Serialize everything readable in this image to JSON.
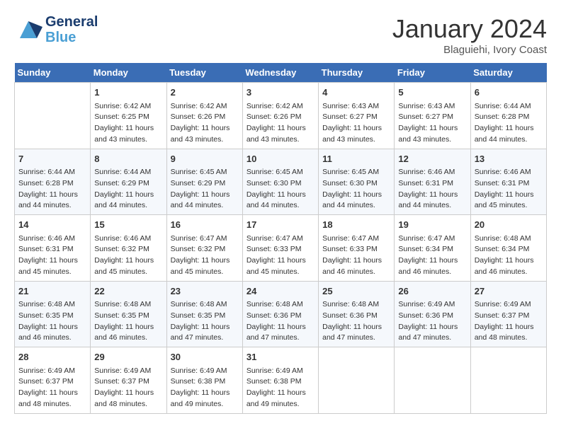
{
  "header": {
    "logo_line1": "General",
    "logo_line2": "Blue",
    "month": "January 2024",
    "location": "Blaguiehi, Ivory Coast"
  },
  "days_of_week": [
    "Sunday",
    "Monday",
    "Tuesday",
    "Wednesday",
    "Thursday",
    "Friday",
    "Saturday"
  ],
  "weeks": [
    [
      {
        "day": "",
        "sunrise": "",
        "sunset": "",
        "daylight": ""
      },
      {
        "day": "1",
        "sunrise": "Sunrise: 6:42 AM",
        "sunset": "Sunset: 6:25 PM",
        "daylight": "Daylight: 11 hours and 43 minutes."
      },
      {
        "day": "2",
        "sunrise": "Sunrise: 6:42 AM",
        "sunset": "Sunset: 6:26 PM",
        "daylight": "Daylight: 11 hours and 43 minutes."
      },
      {
        "day": "3",
        "sunrise": "Sunrise: 6:42 AM",
        "sunset": "Sunset: 6:26 PM",
        "daylight": "Daylight: 11 hours and 43 minutes."
      },
      {
        "day": "4",
        "sunrise": "Sunrise: 6:43 AM",
        "sunset": "Sunset: 6:27 PM",
        "daylight": "Daylight: 11 hours and 43 minutes."
      },
      {
        "day": "5",
        "sunrise": "Sunrise: 6:43 AM",
        "sunset": "Sunset: 6:27 PM",
        "daylight": "Daylight: 11 hours and 43 minutes."
      },
      {
        "day": "6",
        "sunrise": "Sunrise: 6:44 AM",
        "sunset": "Sunset: 6:28 PM",
        "daylight": "Daylight: 11 hours and 44 minutes."
      }
    ],
    [
      {
        "day": "7",
        "sunrise": "Sunrise: 6:44 AM",
        "sunset": "Sunset: 6:28 PM",
        "daylight": "Daylight: 11 hours and 44 minutes."
      },
      {
        "day": "8",
        "sunrise": "Sunrise: 6:44 AM",
        "sunset": "Sunset: 6:29 PM",
        "daylight": "Daylight: 11 hours and 44 minutes."
      },
      {
        "day": "9",
        "sunrise": "Sunrise: 6:45 AM",
        "sunset": "Sunset: 6:29 PM",
        "daylight": "Daylight: 11 hours and 44 minutes."
      },
      {
        "day": "10",
        "sunrise": "Sunrise: 6:45 AM",
        "sunset": "Sunset: 6:30 PM",
        "daylight": "Daylight: 11 hours and 44 minutes."
      },
      {
        "day": "11",
        "sunrise": "Sunrise: 6:45 AM",
        "sunset": "Sunset: 6:30 PM",
        "daylight": "Daylight: 11 hours and 44 minutes."
      },
      {
        "day": "12",
        "sunrise": "Sunrise: 6:46 AM",
        "sunset": "Sunset: 6:31 PM",
        "daylight": "Daylight: 11 hours and 44 minutes."
      },
      {
        "day": "13",
        "sunrise": "Sunrise: 6:46 AM",
        "sunset": "Sunset: 6:31 PM",
        "daylight": "Daylight: 11 hours and 45 minutes."
      }
    ],
    [
      {
        "day": "14",
        "sunrise": "Sunrise: 6:46 AM",
        "sunset": "Sunset: 6:31 PM",
        "daylight": "Daylight: 11 hours and 45 minutes."
      },
      {
        "day": "15",
        "sunrise": "Sunrise: 6:46 AM",
        "sunset": "Sunset: 6:32 PM",
        "daylight": "Daylight: 11 hours and 45 minutes."
      },
      {
        "day": "16",
        "sunrise": "Sunrise: 6:47 AM",
        "sunset": "Sunset: 6:32 PM",
        "daylight": "Daylight: 11 hours and 45 minutes."
      },
      {
        "day": "17",
        "sunrise": "Sunrise: 6:47 AM",
        "sunset": "Sunset: 6:33 PM",
        "daylight": "Daylight: 11 hours and 45 minutes."
      },
      {
        "day": "18",
        "sunrise": "Sunrise: 6:47 AM",
        "sunset": "Sunset: 6:33 PM",
        "daylight": "Daylight: 11 hours and 46 minutes."
      },
      {
        "day": "19",
        "sunrise": "Sunrise: 6:47 AM",
        "sunset": "Sunset: 6:34 PM",
        "daylight": "Daylight: 11 hours and 46 minutes."
      },
      {
        "day": "20",
        "sunrise": "Sunrise: 6:48 AM",
        "sunset": "Sunset: 6:34 PM",
        "daylight": "Daylight: 11 hours and 46 minutes."
      }
    ],
    [
      {
        "day": "21",
        "sunrise": "Sunrise: 6:48 AM",
        "sunset": "Sunset: 6:35 PM",
        "daylight": "Daylight: 11 hours and 46 minutes."
      },
      {
        "day": "22",
        "sunrise": "Sunrise: 6:48 AM",
        "sunset": "Sunset: 6:35 PM",
        "daylight": "Daylight: 11 hours and 46 minutes."
      },
      {
        "day": "23",
        "sunrise": "Sunrise: 6:48 AM",
        "sunset": "Sunset: 6:35 PM",
        "daylight": "Daylight: 11 hours and 47 minutes."
      },
      {
        "day": "24",
        "sunrise": "Sunrise: 6:48 AM",
        "sunset": "Sunset: 6:36 PM",
        "daylight": "Daylight: 11 hours and 47 minutes."
      },
      {
        "day": "25",
        "sunrise": "Sunrise: 6:48 AM",
        "sunset": "Sunset: 6:36 PM",
        "daylight": "Daylight: 11 hours and 47 minutes."
      },
      {
        "day": "26",
        "sunrise": "Sunrise: 6:49 AM",
        "sunset": "Sunset: 6:36 PM",
        "daylight": "Daylight: 11 hours and 47 minutes."
      },
      {
        "day": "27",
        "sunrise": "Sunrise: 6:49 AM",
        "sunset": "Sunset: 6:37 PM",
        "daylight": "Daylight: 11 hours and 48 minutes."
      }
    ],
    [
      {
        "day": "28",
        "sunrise": "Sunrise: 6:49 AM",
        "sunset": "Sunset: 6:37 PM",
        "daylight": "Daylight: 11 hours and 48 minutes."
      },
      {
        "day": "29",
        "sunrise": "Sunrise: 6:49 AM",
        "sunset": "Sunset: 6:37 PM",
        "daylight": "Daylight: 11 hours and 48 minutes."
      },
      {
        "day": "30",
        "sunrise": "Sunrise: 6:49 AM",
        "sunset": "Sunset: 6:38 PM",
        "daylight": "Daylight: 11 hours and 49 minutes."
      },
      {
        "day": "31",
        "sunrise": "Sunrise: 6:49 AM",
        "sunset": "Sunset: 6:38 PM",
        "daylight": "Daylight: 11 hours and 49 minutes."
      },
      {
        "day": "",
        "sunrise": "",
        "sunset": "",
        "daylight": ""
      },
      {
        "day": "",
        "sunrise": "",
        "sunset": "",
        "daylight": ""
      },
      {
        "day": "",
        "sunrise": "",
        "sunset": "",
        "daylight": ""
      }
    ]
  ]
}
